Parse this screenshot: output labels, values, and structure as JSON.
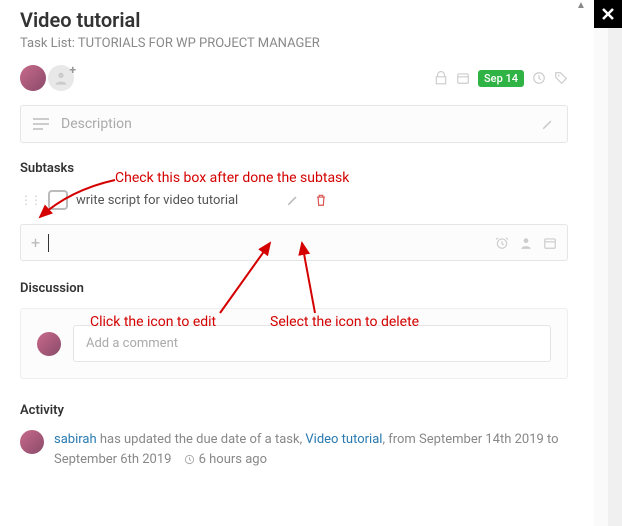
{
  "title": "Video tutorial",
  "tasklist_prefix": "Task List: ",
  "tasklist_name": "TUTORIALS FOR WP PROJECT MANAGER",
  "due_badge": "Sep 14",
  "description_placeholder": "Description",
  "sections": {
    "subtasks": "Subtasks",
    "discussion": "Discussion",
    "activity": "Activity"
  },
  "subtask": {
    "text": "write script for video tutorial"
  },
  "new_subtask_placeholder": "",
  "comment_placeholder": "Add a comment",
  "annotations": {
    "checkbox": "Check this box after done the subtask",
    "edit": "Click the icon to edit",
    "delete": "Select the icon to delete"
  },
  "activity": {
    "user": "sabirah",
    "text1": " has updated the due date of a task, ",
    "task_link": "Video tutorial",
    "text2": ", from September 14th 2019 to September 6th 2019",
    "time": "6 hours ago"
  }
}
